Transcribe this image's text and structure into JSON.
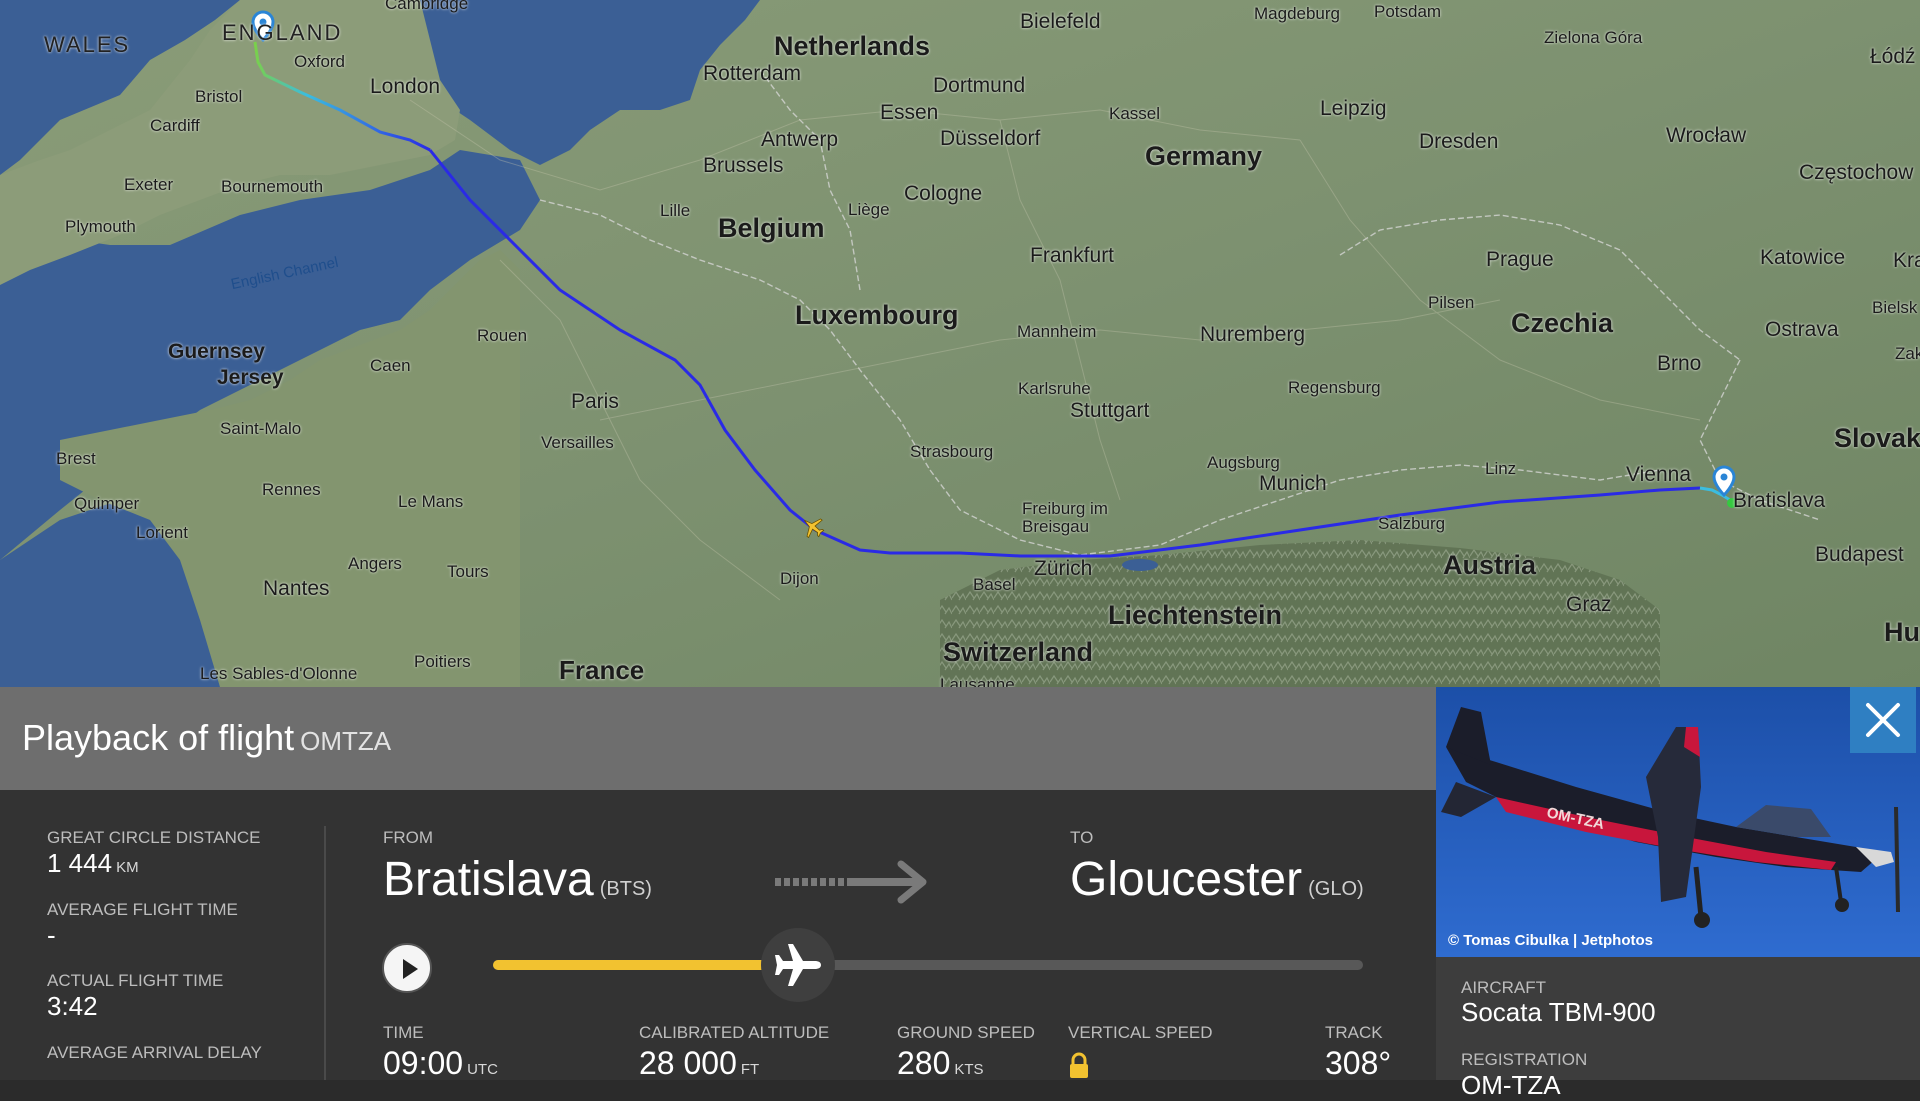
{
  "map": {
    "labels": {
      "wales": "WALES",
      "england": "ENGLAND",
      "cambridge": "Cambridge",
      "oxford": "Oxford",
      "london": "London",
      "bristol": "Bristol",
      "cardiff": "Cardiff",
      "exeter": "Exeter",
      "bournemouth": "Bournemouth",
      "plymouth": "Plymouth",
      "english_channel": "English Channel",
      "guernsey": "Guernsey",
      "jersey": "Jersey",
      "saint_malo": "Saint-Malo",
      "brest": "Brest",
      "quimper": "Quimper",
      "lorient": "Lorient",
      "rennes": "Rennes",
      "le_mans": "Le Mans",
      "angers": "Angers",
      "tours": "Tours",
      "nantes": "Nantes",
      "poitiers": "Poitiers",
      "les_sables": "Les Sables-d'Olonne",
      "france": "France",
      "caen": "Caen",
      "rouen": "Rouen",
      "paris": "Paris",
      "versailles": "Versailles",
      "dijon": "Dijon",
      "lille": "Lille",
      "belgium": "Belgium",
      "brussels": "Brussels",
      "antwerp": "Antwerp",
      "rotterdam": "Rotterdam",
      "netherlands": "Netherlands",
      "liege": "Liège",
      "luxembourg": "Luxembourg",
      "essen": "Essen",
      "dortmund": "Dortmund",
      "dusseldorf": "Düsseldorf",
      "cologne": "Cologne",
      "bielefeld": "Bielefeld",
      "magdeburg": "Magdeburg",
      "potsdam": "Potsdam",
      "kassel": "Kassel",
      "leipzig": "Leipzig",
      "germany": "Germany",
      "dresden": "Dresden",
      "frankfurt": "Frankfurt",
      "mannheim": "Mannheim",
      "karlsruhe": "Karlsruhe",
      "stuttgart": "Stuttgart",
      "strasbourg": "Strasbourg",
      "nuremberg": "Nuremberg",
      "regensburg": "Regensburg",
      "augsburg": "Augsburg",
      "munich": "Munich",
      "freiburg": "Freiburg im Breisgau",
      "basel": "Basel",
      "zurich": "Zürich",
      "switzerland": "Switzerland",
      "liechtenstein": "Liechtenstein",
      "lausanne": "Lausanne",
      "salzburg": "Salzburg",
      "linz": "Linz",
      "austria": "Austria",
      "graz": "Graz",
      "vienna": "Vienna",
      "bratislava": "Bratislava",
      "budapest": "Budapest",
      "hung": "Hung",
      "slovak": "Slovak",
      "brno": "Brno",
      "czechia": "Czechia",
      "prague": "Prague",
      "pilsen": "Pilsen",
      "ostrava": "Ostrava",
      "katowice": "Katowice",
      "kra": "Kra",
      "bielsk": "Bielsk",
      "zak": "Zak",
      "czestochow": "Częstochow",
      "wroclaw": "Wrocław",
      "zielona_gora": "Zielona Góra",
      "lodz": "Łódź"
    }
  },
  "panel": {
    "title": "Playback of flight",
    "callsign": "OMTZA",
    "close_icon": "close-icon",
    "stats": {
      "great_circle_label": "GREAT CIRCLE DISTANCE",
      "great_circle_value": "1 444",
      "great_circle_unit": "KM",
      "avg_flight_time_label": "AVERAGE FLIGHT TIME",
      "avg_flight_time_value": "-",
      "actual_flight_time_label": "ACTUAL FLIGHT TIME",
      "actual_flight_time_value": "3:42",
      "avg_arrival_delay_label": "AVERAGE ARRIVAL DELAY"
    },
    "route": {
      "from_label": "FROM",
      "from_city": "Bratislava",
      "from_code": "(BTS)",
      "to_label": "TO",
      "to_city": "Gloucester",
      "to_code": "(GLO)"
    },
    "playback": {
      "progress": 0.35
    },
    "telemetry": {
      "time_label": "TIME",
      "time_value": "09:00",
      "time_unit": "UTC",
      "alt_label": "CALIBRATED ALTITUDE",
      "alt_value": "28 000",
      "alt_unit": "FT",
      "gs_label": "GROUND SPEED",
      "gs_value": "280",
      "gs_unit": "KTS",
      "vs_label": "VERTICAL SPEED",
      "track_label": "TRACK",
      "track_value": "308°"
    },
    "photo": {
      "credit": "© Tomas Cibulka | Jetphotos",
      "registration_marking": "OM-TZA"
    },
    "aircraft": {
      "aircraft_label": "AIRCRAFT",
      "aircraft_value": "Socata TBM-900",
      "registration_label": "REGISTRATION",
      "registration_value": "OM-TZA"
    },
    "colors": {
      "accent": "#f2c230",
      "route_line": "#2a2ae6",
      "close_bg": "#2f7fc2"
    }
  }
}
